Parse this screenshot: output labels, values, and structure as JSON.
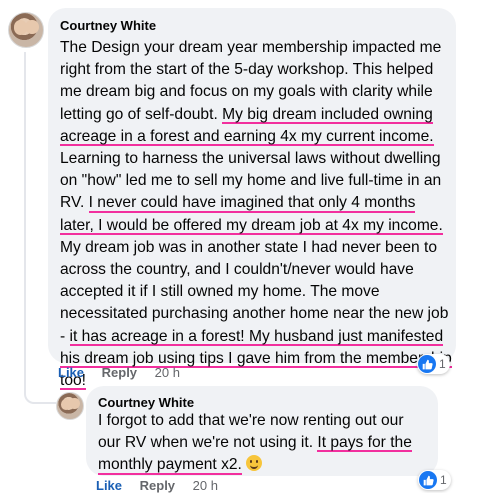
{
  "comment": {
    "author": "Courtney White",
    "segments": [
      {
        "text": "The Design your dream year membership impacted me right from the start of the 5-day workshop. This helped me dream big and focus on my goals with clarity while letting go of self-doubt. ",
        "hl": false
      },
      {
        "text": "My big dream included owning acreage in a forest and earning 4x my current income.",
        "hl": true
      },
      {
        "text": " Learning to harness the universal laws without dwelling on \"how\" led me to sell my home and live full-time in an RV. ",
        "hl": false
      },
      {
        "text": "I never could have imagined that only 4 months later, I would be offered my dream job at 4x my income.",
        "hl": true
      },
      {
        "text": " My dream job was in another state I had never been to across the country, and I couldn't/never would have accepted it if I still owned my home. The move necessitated purchasing another home near the new job - ",
        "hl": false
      },
      {
        "text": "it has acreage in a forest! My husband just manifested his dream job using tips I gave him from the membership too!",
        "hl": true
      }
    ],
    "actions": {
      "like": "Like",
      "reply": "Reply",
      "time": "20 h"
    },
    "reaction_count": "1"
  },
  "reply": {
    "author": "Courtney White",
    "segments": [
      {
        "text": "I forgot to add that we're now renting out our our RV when we're not using it. ",
        "hl": false
      },
      {
        "text": "It pays for the monthly payment x2.",
        "hl": true
      },
      {
        "text": " ",
        "hl": false
      }
    ],
    "emoji": "smile-emoji",
    "actions": {
      "like": "Like",
      "reply": "Reply",
      "time": "20 h"
    },
    "reaction_count": "1"
  },
  "colors": {
    "highlight": "#f22f9e",
    "link": "#1a5fb4",
    "bubble": "#f0f2f5"
  }
}
